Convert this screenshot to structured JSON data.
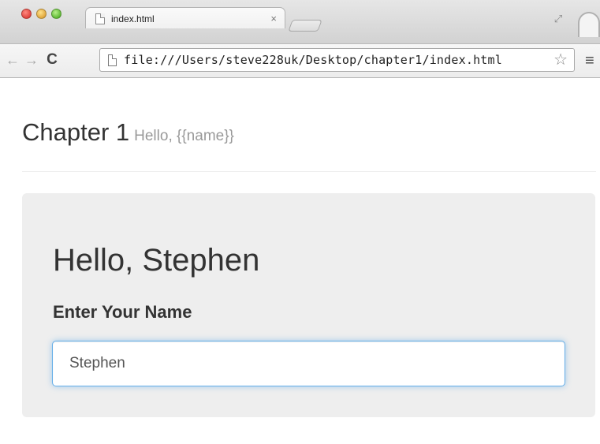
{
  "browser": {
    "tab_title": "index.html",
    "tab_close": "×",
    "url": "file:///Users/steve228uk/Desktop/chapter1/index.html",
    "icons": {
      "back": "←",
      "forward": "→",
      "reload": "C",
      "star": "☆",
      "menu": "≡",
      "fullscreen": "⤢"
    }
  },
  "page": {
    "header": {
      "title": "Chapter 1",
      "subtitle": "Hello, {{name}}"
    },
    "jumbotron": {
      "greeting": "Hello, Stephen",
      "label": "Enter Your Name",
      "input_value": "Stephen"
    }
  },
  "colors": {
    "focus_border": "#66afe9",
    "jumbotron_bg": "#eeeeee"
  }
}
